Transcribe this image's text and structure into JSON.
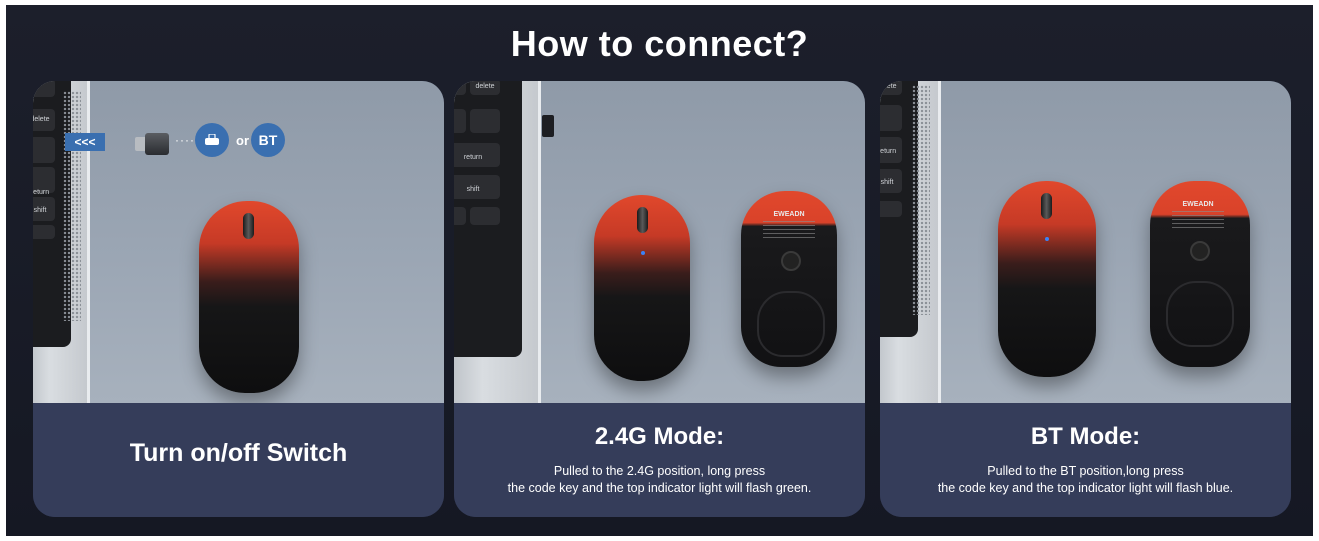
{
  "title": "How to connect?",
  "panels": [
    {
      "caption_title": "Turn on/off Switch",
      "arrows": "<<<",
      "or_label": "or",
      "bt_badge": "BT",
      "keys": [
        "delete",
        "return",
        "shift"
      ]
    },
    {
      "caption_title": "2.4G Mode:",
      "caption_line1": "Pulled to the 2.4G position, long press",
      "caption_line2": "the code key and the top indicator light will flash green.",
      "mouse_brand": "EWEADN",
      "keys": [
        "delete",
        "return",
        "shift"
      ]
    },
    {
      "caption_title": "BT Mode:",
      "caption_line1": "Pulled to the BT position,long press",
      "caption_line2": "the code key and the top indicator light will flash blue.",
      "mouse_brand": "EWEADN",
      "keys": [
        "delete",
        "return",
        "shift"
      ]
    }
  ],
  "colors": {
    "background": "#1c1f2b",
    "caption_panel": "#353d5a",
    "accent_blue": "#3a6fb0",
    "mouse_red": "#e1482c"
  }
}
